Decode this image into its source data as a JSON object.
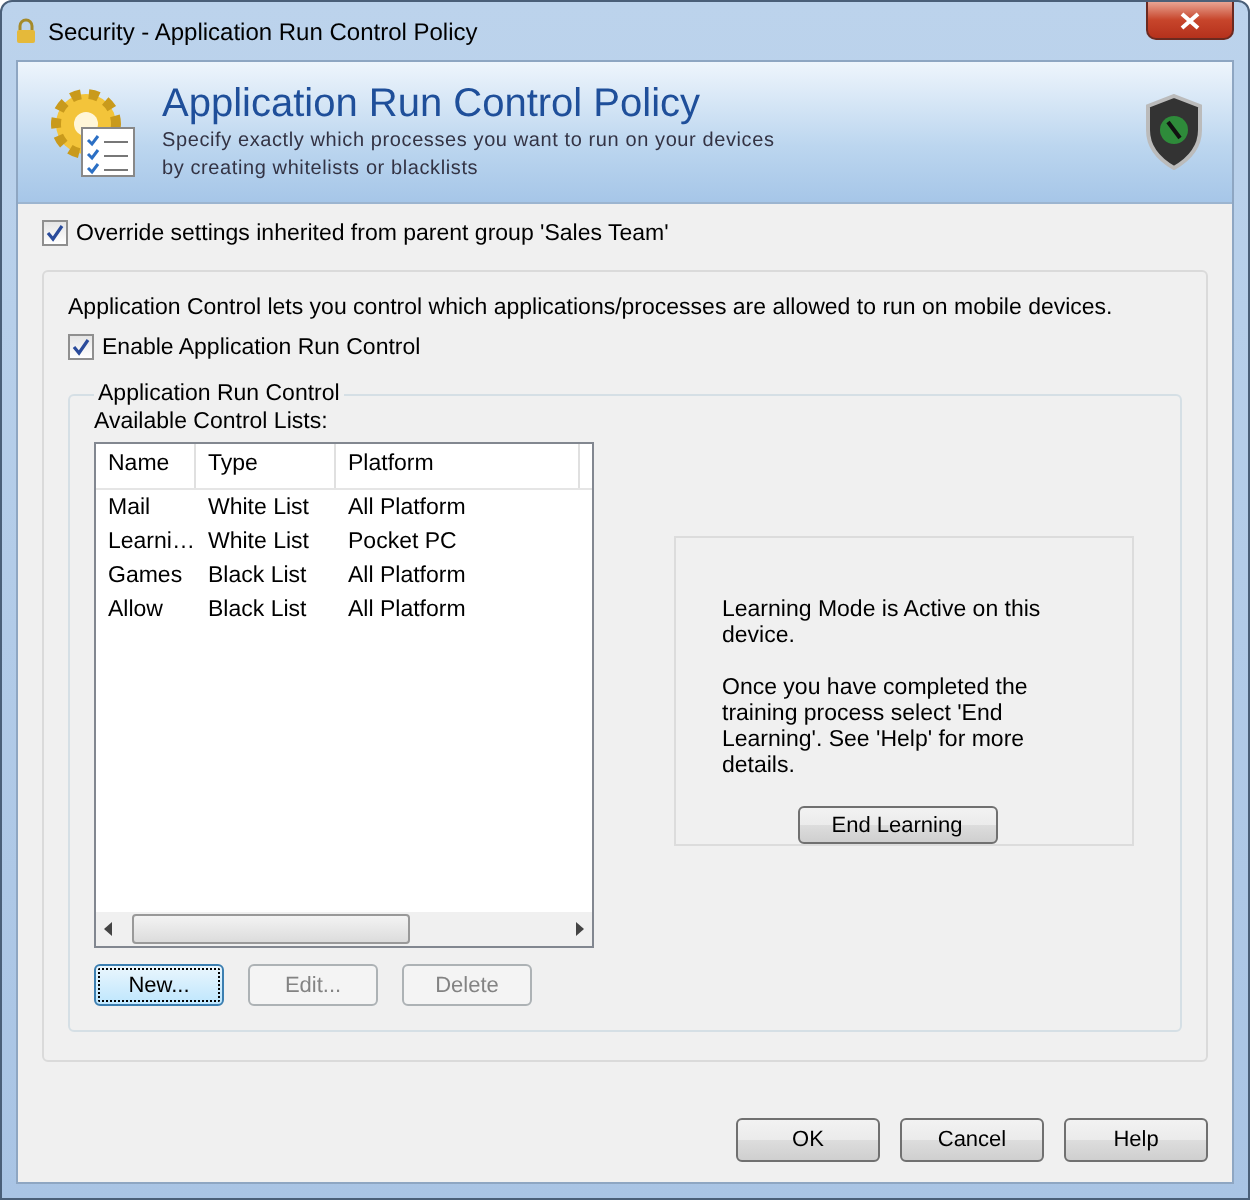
{
  "window": {
    "title": "Security - Application Run Control Policy"
  },
  "header": {
    "title": "Application Run Control Policy",
    "subtitle_lines": [
      "Specify exactly which processes you want to run on your devices",
      "by creating whitelists or blacklists"
    ]
  },
  "override": {
    "label": "Override settings inherited from parent group 'Sales Team'",
    "checked": true
  },
  "description": "Application Control lets you control which applications/processes are allowed to run on mobile devices.",
  "enable": {
    "label": "Enable Application Run Control",
    "checked": true
  },
  "group": {
    "title": "Application Run Control",
    "list_label": "Available Control Lists:",
    "columns": [
      "Name",
      "Type",
      "Platform"
    ],
    "rows": [
      {
        "cells": [
          "Mail",
          "White List",
          "All Platform"
        ],
        "selected": false
      },
      {
        "cells": [
          "Learni…",
          "White List",
          "Pocket PC"
        ],
        "selected": false
      },
      {
        "cells": [
          "Games",
          "Black List",
          "All Platform"
        ],
        "selected": false
      },
      {
        "cells": [
          "Allow",
          "Black List",
          "All Platform"
        ],
        "selected": false
      }
    ],
    "buttons": [
      {
        "label": "New...",
        "disabled": false,
        "focused": true
      },
      {
        "label": "Edit...",
        "disabled": true,
        "focused": false
      },
      {
        "label": "Delete",
        "disabled": true,
        "focused": false
      }
    ],
    "learning": {
      "status": "Learning Mode is Active on this device.",
      "message": "Once you have completed the training process select 'End Learning'. See 'Help' for more details.",
      "button": "End Learning"
    }
  },
  "footer_buttons": [
    "OK",
    "Cancel",
    "Help"
  ]
}
